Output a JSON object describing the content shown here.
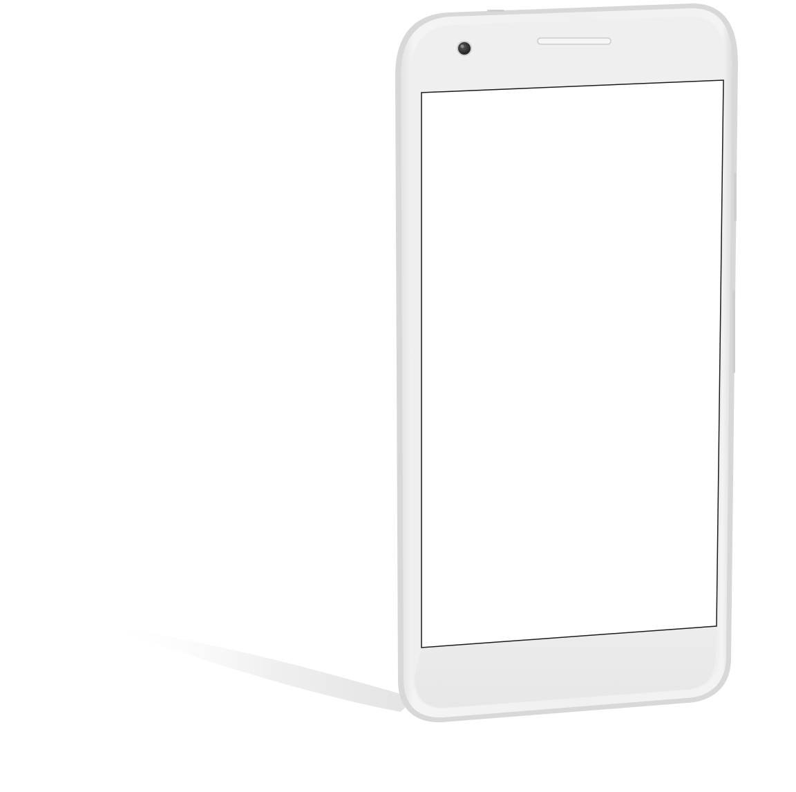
{
  "scene": {
    "subject": "smartphone-mockup",
    "background_color": "#ffffff",
    "body_color": "#eeeeee",
    "body_edge_color": "#d9d9d9",
    "screen_color": "#ffffff",
    "screen_border_color": "#1a1a1a",
    "shadow_color": "#e6e6e6",
    "camera_color": "#2a2a2a",
    "speaker_color": "#d0d0d0",
    "icons": [
      "front-camera-icon",
      "earpiece-speaker-icon"
    ]
  }
}
